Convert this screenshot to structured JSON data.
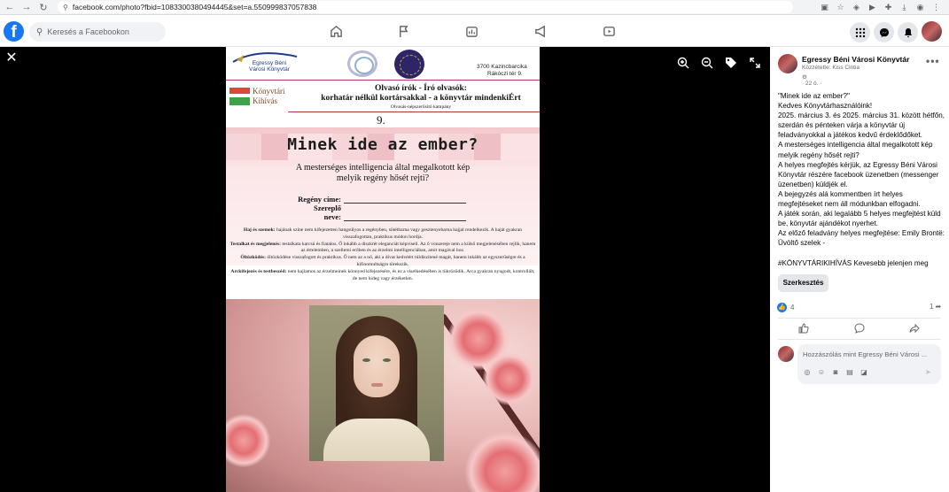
{
  "browser": {
    "url": "facebook.com/photo?fbid=1083300380494445&set=a.550999837057838",
    "icons": [
      "back-icon",
      "forward-icon",
      "reload-icon",
      "site-info-icon",
      "install-icon",
      "star-icon",
      "extension-icon",
      "download-icon",
      "profile-icon",
      "menu-icon"
    ]
  },
  "facebook": {
    "logo": "f",
    "search_placeholder": "Keresés a Facebookon",
    "nav": [
      "home-icon",
      "flag-icon",
      "pages-icon",
      "megaphone-icon",
      "video-icon"
    ],
    "right_icons": [
      "apps-grid-icon",
      "messenger-icon",
      "bell-icon"
    ]
  },
  "viewer": {
    "close": "✕",
    "tools": [
      "zoom-in-icon",
      "zoom-out-icon",
      "tag-icon",
      "fullscreen-icon"
    ]
  },
  "poster": {
    "library_name_1": "Egressy Béni",
    "library_name_2": "Városi Könyvtár",
    "address_1": "3700 Kazincbarcika",
    "address_2": "Rákóczi tér 9.",
    "kihivas_1": "Könyvtári",
    "kihivas_2": "Kihívás",
    "campaign_1": "Olvasó írók - Író olvasók:",
    "campaign_2": "korhatár nélkül kortársakkal - a könyvtár mindenkiÉrt",
    "campaign_3": "Olvasás-népszerűsítő kampány",
    "number": "9.",
    "title": "Minek ide az ember?",
    "question_1": "A mesterséges intelligencia által megalkotott kép",
    "question_2": "melyik regény hősét rejti?",
    "field_1": "Regény címe:",
    "field_2": "Szereplő neve:",
    "desc": [
      {
        "b": "Haj és szemek:",
        "t": " hajának színe nem kifejezetten hangsúlyos a regényben, sötétbarna vagy gesztenyebarna hajjal rendelkezik. A haját gyakran visszafogottan, praktikus módon hordja."
      },
      {
        "b": "Testalkat és megjelenés:",
        "t": " testalkata karcsú és fiatalos. Ő inkább a diszkrét eleganciát képviseli. Az ő vonzereje nem a külső megjelenésében rejlik, hanem az értelemben, a szellemi erőben és az érzelmi intelligenciában, amit magával hoz."
      },
      {
        "b": "Öltözködés:",
        "t": " öltözködése visszafogott és praktikus. Ő nem az a nő, aki a divat kedvéért túldíszítené magát, hanem inkább az egyszerűségre és a kifinomultságra törekszik."
      },
      {
        "b": "Arckifejezés és testbeszéd:",
        "t": " nem hajlamos az érzelmeinek könnyed kifejezésére, és ez a viselkedésében is tükröződik. Arca gyakran nyugodt, kontrollált, de nem hideg vagy érzéketlen."
      }
    ]
  },
  "post": {
    "page_name": "Egressy Béni Városi Könyvtár",
    "published_by": "Közzétette: Kiss Cintia",
    "meta_icon": "⚙",
    "time": "· 22 ó. ·",
    "more": "•••",
    "lines": [
      "\"Minek ide az ember?\"",
      "Kedves Könyvtárhasználóink!",
      "2025. március 3. és 2025. március 31. között hétfőn, szerdán és pénteken várja a könyvtár új feladványokkal a játékos kedvű érdeklődőket.",
      "A mesterséges intelligencia által megalkotott kép melyik regény hősét rejti?",
      "A helyes megfejtés kérjük, az Egressy Béni Városi Könyvtár részére facebook üzenetben (messenger üzenetben) küldjék el.",
      "A bejegyzés alá kommentben írt helyes megfejtéseket nem áll módunkban elfogadni.",
      "A játék során, aki legalább 5 helyes megfejtést küld be, könyvtár ajándékot nyerhet.",
      "Az előző feladvány helyes megfejtése: Emily Brontë: Üvöltő szelek -",
      "",
      "#KÖNYVTÁRIKIHÍVÁS Kevesebb jelenjen meg"
    ],
    "edit_button": "Szerkesztés",
    "reactions": "4",
    "shares": "1",
    "comment_placeholder": "Hozzászólás mint Egressy Béni Városi ..."
  },
  "colors": {
    "facebook_blue": "#1877f2",
    "viewer_bg": "#000000"
  }
}
